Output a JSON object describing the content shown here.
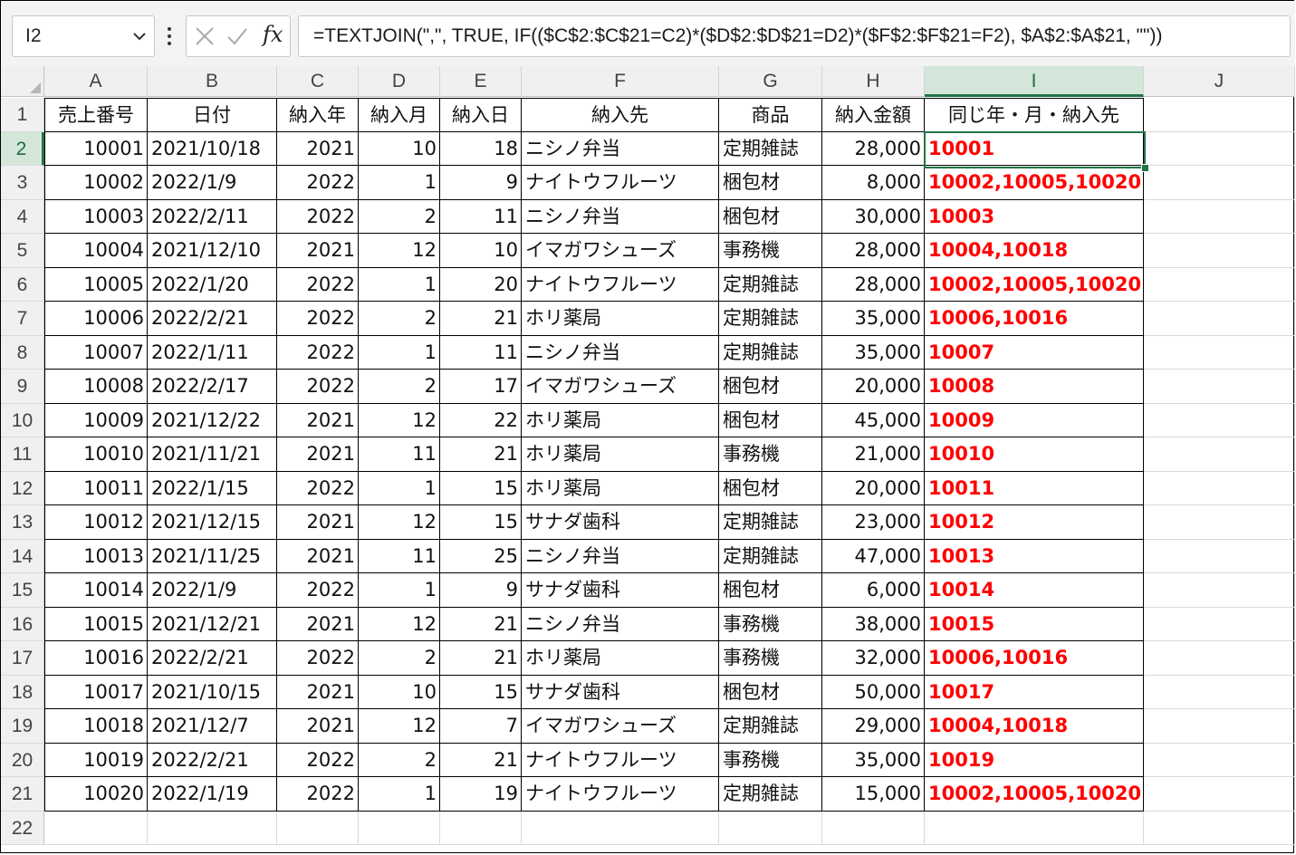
{
  "name_box": {
    "value": "I2"
  },
  "formula_bar": {
    "cancel_icon": "x-icon",
    "enter_icon": "check-icon",
    "fx_label": "fx",
    "formula": "=TEXTJOIN(\",\", TRUE, IF(($C$2:$C$21=C2)*($D$2:$D$21=D2)*($F$2:$F$21=F2), $A$2:$A$21, \"\"))"
  },
  "columns": [
    "A",
    "B",
    "C",
    "D",
    "E",
    "F",
    "G",
    "H",
    "I",
    "J"
  ],
  "selected_column": "I",
  "selected_row": "2",
  "row_numbers": [
    "1",
    "2",
    "3",
    "4",
    "5",
    "6",
    "7",
    "8",
    "9",
    "10",
    "11",
    "12",
    "13",
    "14",
    "15",
    "16",
    "17",
    "18",
    "19",
    "20",
    "21",
    "22"
  ],
  "headers": [
    "売上番号",
    "日付",
    "納入年",
    "納入月",
    "納入日",
    "納入先",
    "商品",
    "納入金額",
    "同じ年・月・納入先"
  ],
  "rows": [
    [
      "10001",
      "2021/10/18",
      "2021",
      "10",
      "18",
      "ニシノ弁当",
      "定期雑誌",
      "28,000",
      "10001"
    ],
    [
      "10002",
      "2022/1/9",
      "2022",
      "1",
      "9",
      "ナイトウフルーツ",
      "梱包材",
      "8,000",
      "10002,10005,10020"
    ],
    [
      "10003",
      "2022/2/11",
      "2022",
      "2",
      "11",
      "ニシノ弁当",
      "梱包材",
      "30,000",
      "10003"
    ],
    [
      "10004",
      "2021/12/10",
      "2021",
      "12",
      "10",
      "イマガワシューズ",
      "事務機",
      "28,000",
      "10004,10018"
    ],
    [
      "10005",
      "2022/1/20",
      "2022",
      "1",
      "20",
      "ナイトウフルーツ",
      "定期雑誌",
      "28,000",
      "10002,10005,10020"
    ],
    [
      "10006",
      "2022/2/21",
      "2022",
      "2",
      "21",
      "ホリ薬局",
      "定期雑誌",
      "35,000",
      "10006,10016"
    ],
    [
      "10007",
      "2022/1/11",
      "2022",
      "1",
      "11",
      "ニシノ弁当",
      "定期雑誌",
      "35,000",
      "10007"
    ],
    [
      "10008",
      "2022/2/17",
      "2022",
      "2",
      "17",
      "イマガワシューズ",
      "梱包材",
      "20,000",
      "10008"
    ],
    [
      "10009",
      "2021/12/22",
      "2021",
      "12",
      "22",
      "ホリ薬局",
      "梱包材",
      "45,000",
      "10009"
    ],
    [
      "10010",
      "2021/11/21",
      "2021",
      "11",
      "21",
      "ホリ薬局",
      "事務機",
      "21,000",
      "10010"
    ],
    [
      "10011",
      "2022/1/15",
      "2022",
      "1",
      "15",
      "ホリ薬局",
      "梱包材",
      "20,000",
      "10011"
    ],
    [
      "10012",
      "2021/12/15",
      "2021",
      "12",
      "15",
      "サナダ歯科",
      "定期雑誌",
      "23,000",
      "10012"
    ],
    [
      "10013",
      "2021/11/25",
      "2021",
      "11",
      "25",
      "ニシノ弁当",
      "定期雑誌",
      "47,000",
      "10013"
    ],
    [
      "10014",
      "2022/1/9",
      "2022",
      "1",
      "9",
      "サナダ歯科",
      "梱包材",
      "6,000",
      "10014"
    ],
    [
      "10015",
      "2021/12/21",
      "2021",
      "12",
      "21",
      "ニシノ弁当",
      "事務機",
      "38,000",
      "10015"
    ],
    [
      "10016",
      "2022/2/21",
      "2022",
      "2",
      "21",
      "ホリ薬局",
      "事務機",
      "32,000",
      "10006,10016"
    ],
    [
      "10017",
      "2021/10/15",
      "2021",
      "10",
      "15",
      "サナダ歯科",
      "梱包材",
      "50,000",
      "10017"
    ],
    [
      "10018",
      "2021/12/7",
      "2021",
      "12",
      "7",
      "イマガワシューズ",
      "定期雑誌",
      "29,000",
      "10004,10018"
    ],
    [
      "10019",
      "2022/2/21",
      "2022",
      "2",
      "21",
      "ナイトウフルーツ",
      "事務機",
      "35,000",
      "10019"
    ],
    [
      "10020",
      "2022/1/19",
      "2022",
      "1",
      "19",
      "ナイトウフルーツ",
      "定期雑誌",
      "15,000",
      "10002,10005,10020"
    ]
  ],
  "colors": {
    "accent": "#217346",
    "result_text": "#ff0000"
  }
}
